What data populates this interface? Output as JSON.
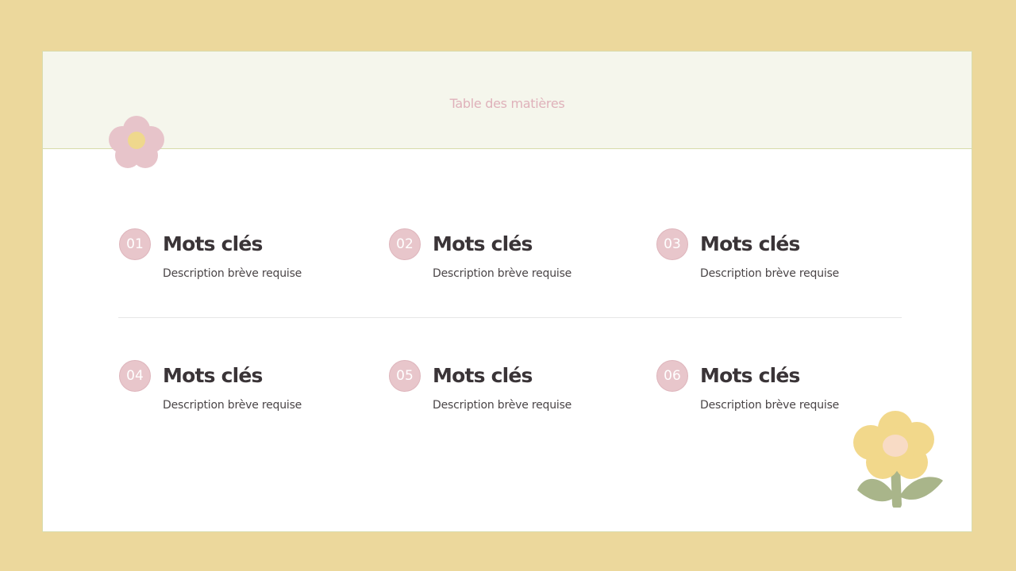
{
  "header": {
    "title": "Table des matières"
  },
  "items": [
    {
      "number": "01",
      "title": "Mots clés",
      "description": "Description brève requise"
    },
    {
      "number": "02",
      "title": "Mots clés",
      "description": "Description brève requise"
    },
    {
      "number": "03",
      "title": "Mots clés",
      "description": "Description brève requise"
    },
    {
      "number": "04",
      "title": "Mots clés",
      "description": "Description brève requise"
    },
    {
      "number": "05",
      "title": "Mots clés",
      "description": "Description brève requise"
    },
    {
      "number": "06",
      "title": "Mots clés",
      "description": "Description brève requise"
    }
  ],
  "colors": {
    "page_background": "#ecd89c",
    "header_background": "#f5f6ec",
    "accent_pink": "#e8c6cb",
    "title_pink": "#dfb1ba",
    "heading_text": "#3a3437",
    "flower_yellow": "#f2d88b",
    "leaf_green": "#a9b58a"
  },
  "decorations": {
    "top_flower_icon": "pink-flower-icon",
    "bottom_flower_icon": "yellow-flower-icon"
  }
}
